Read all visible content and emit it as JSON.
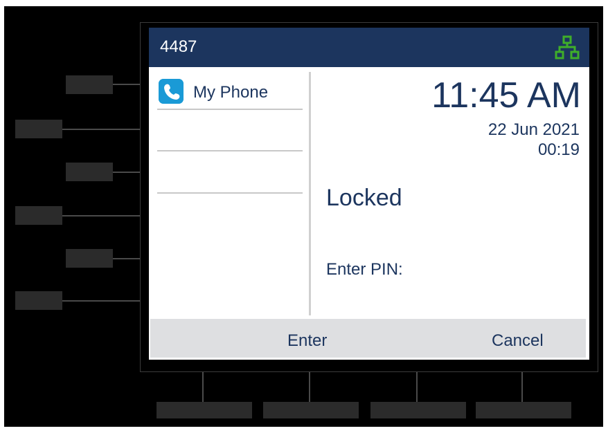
{
  "header": {
    "extension": "4487",
    "network_icon": "network-icon",
    "network_color": "#3fae29"
  },
  "line_keys": [
    {
      "label": "My Phone",
      "icon": "phone-icon",
      "icon_color": "#1a9ad6"
    }
  ],
  "status": {
    "time": "11:45 AM",
    "date": "22 Jun 2021",
    "call_timer": "00:19",
    "state": "Locked",
    "pin_prompt": "Enter PIN:"
  },
  "softkeys": [
    {
      "label": "Enter"
    },
    {
      "label": "Cancel"
    }
  ],
  "colors": {
    "header_bg": "#1c355e",
    "text": "#1c355e",
    "softkey_bar": "#dedfe1"
  }
}
